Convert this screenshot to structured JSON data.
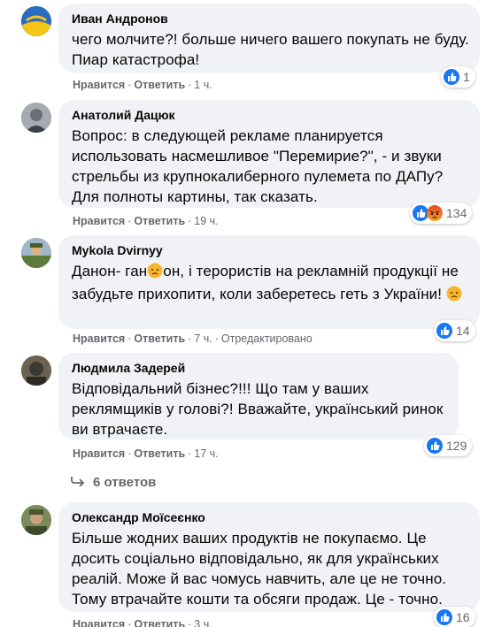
{
  "colors": {
    "bubble": "#f0f2f5",
    "meta": "#65676b",
    "like_blue": "#1877f2",
    "angry_orange": "#e9710f"
  },
  "comments": [
    {
      "author": "Иван Андронов",
      "text": "чего молчите?! больше ничего вашего покупать не буду. Пиар катастрофа!",
      "like": "Нравится",
      "reply": "Ответить",
      "time": "1 ч.",
      "reactions": [
        "like-icon"
      ],
      "count": "1"
    },
    {
      "author": "Анатолий Дацюк",
      "text": "Вопрос: в следующей рекламе планируется использовать насмешливое \"Перемирие?\", - и звуки стрельбы из крупнокалиберного пулемета по ДАПу? Для полноты картины, так сказать.",
      "like": "Нравится",
      "reply": "Ответить",
      "time": "19 ч.",
      "reactions": [
        "like-icon",
        "angry-icon"
      ],
      "count": "134"
    },
    {
      "author": "Mykola Dvirnyy",
      "text_a": "Данон- ган",
      "text_b": "он, і терористів на рекламній продукції не забудьте прихопити, коли заберетесь геть з України!",
      "like": "Нравится",
      "reply": "Ответить",
      "time": "7 ч.",
      "edited": "Отредактировано",
      "reactions": [
        "like-icon"
      ],
      "count": "14"
    },
    {
      "author": "Людмила Задерей",
      "text": "Відповідальний бізнес?!!! Що там у ваших реклямщиків у голові?! Вважайте, український ринок ви втрачаєте.",
      "like": "Нравится",
      "reply": "Ответить",
      "time": "17 ч.",
      "reactions": [
        "like-icon"
      ],
      "count": "129"
    },
    {
      "author": "Олександр Моїсеєнко",
      "text": "Більше жодних ваших продуктів не покупаємо. Це досить соціально відповідально, як для українських реалій. Може й вас чомусь навчить, але це не точно. Тому втрачайте кошти та обсяги продаж. Це - точно.",
      "like": "Нравится",
      "reply": "Ответить",
      "time": "3 ч.",
      "reactions": [
        "like-icon"
      ],
      "count": "16"
    }
  ],
  "replies_link": "6 ответов",
  "icons": {
    "reply_arrow": "reply-arrow-icon",
    "angry_face": "angry-face-icon"
  }
}
